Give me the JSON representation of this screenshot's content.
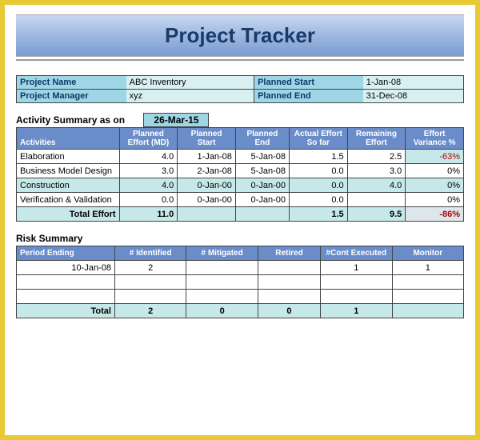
{
  "title": "Project Tracker",
  "info": {
    "project_name_label": "Project Name",
    "project_name_value": "ABC Inventory",
    "project_manager_label": "Project Manager",
    "project_manager_value": "xyz",
    "planned_start_label": "Planned Start",
    "planned_start_value": "1-Jan-08",
    "planned_end_label": "Planned End",
    "planned_end_value": "31-Dec-08"
  },
  "activity": {
    "heading": "Activity Summary as on",
    "as_on_date": "26-Mar-15",
    "headers": {
      "activities": "Activities",
      "planned_effort": "Planned Effort (MD)",
      "planned_start": "Planned Start",
      "planned_end": "Planned End",
      "actual_effort": "Actual Effort So far",
      "remaining_effort": "Remaining Effort",
      "variance": "Effort Variance %"
    },
    "rows": [
      {
        "name": "Elaboration",
        "pe": "4.0",
        "ps": "1-Jan-08",
        "pend": "5-Jan-08",
        "ae": "1.5",
        "re": "2.5",
        "var": "-63%"
      },
      {
        "name": "Business Model Design",
        "pe": "3.0",
        "ps": "2-Jan-08",
        "pend": "5-Jan-08",
        "ae": "0.0",
        "re": "3.0",
        "var": "0%"
      },
      {
        "name": "Construction",
        "pe": "4.0",
        "ps": "0-Jan-00",
        "pend": "0-Jan-00",
        "ae": "0.0",
        "re": "4.0",
        "var": "0%"
      },
      {
        "name": "Verification & Validation",
        "pe": "0.0",
        "ps": "0-Jan-00",
        "pend": "0-Jan-00",
        "ae": "0.0",
        "re": "",
        "var": "0%"
      }
    ],
    "total": {
      "name": "Total Effort",
      "pe": "11.0",
      "ps": "",
      "pend": "",
      "ae": "1.5",
      "re": "9.5",
      "var": "-86%"
    }
  },
  "risk": {
    "heading": "Risk Summary",
    "headers": {
      "period": "Period Ending",
      "identified": "# Identified",
      "mitigated": "# Mitigated",
      "retired": "Retired",
      "cont": "#Cont Executed",
      "monitor": "Monitor"
    },
    "rows": [
      {
        "period": "10-Jan-08",
        "identified": "2",
        "mitigated": "",
        "retired": "",
        "cont": "1",
        "monitor": "1"
      },
      {
        "period": "",
        "identified": "",
        "mitigated": "",
        "retired": "",
        "cont": "",
        "monitor": ""
      },
      {
        "period": "",
        "identified": "",
        "mitigated": "",
        "retired": "",
        "cont": "",
        "monitor": ""
      }
    ],
    "total": {
      "period": "Total",
      "identified": "2",
      "mitigated": "0",
      "retired": "0",
      "cont": "1",
      "monitor": ""
    }
  },
  "chart_data": [
    {
      "type": "table",
      "title": "Activity Summary as on 26-Mar-15",
      "columns": [
        "Activities",
        "Planned Effort (MD)",
        "Planned Start",
        "Planned End",
        "Actual Effort So far",
        "Remaining Effort",
        "Effort Variance %"
      ],
      "rows": [
        [
          "Elaboration",
          4.0,
          "1-Jan-08",
          "5-Jan-08",
          1.5,
          2.5,
          "-63%"
        ],
        [
          "Business Model Design",
          3.0,
          "2-Jan-08",
          "5-Jan-08",
          0.0,
          3.0,
          "0%"
        ],
        [
          "Construction",
          4.0,
          "0-Jan-00",
          "0-Jan-00",
          0.0,
          4.0,
          "0%"
        ],
        [
          "Verification & Validation",
          0.0,
          "0-Jan-00",
          "0-Jan-00",
          0.0,
          null,
          "0%"
        ],
        [
          "Total Effort",
          11.0,
          null,
          null,
          1.5,
          9.5,
          "-86%"
        ]
      ]
    },
    {
      "type": "table",
      "title": "Risk Summary",
      "columns": [
        "Period Ending",
        "# Identified",
        "# Mitigated",
        "Retired",
        "#Cont Executed",
        "Monitor"
      ],
      "rows": [
        [
          "10-Jan-08",
          2,
          null,
          null,
          1,
          1
        ],
        [
          "Total",
          2,
          0,
          0,
          1,
          null
        ]
      ]
    }
  ]
}
